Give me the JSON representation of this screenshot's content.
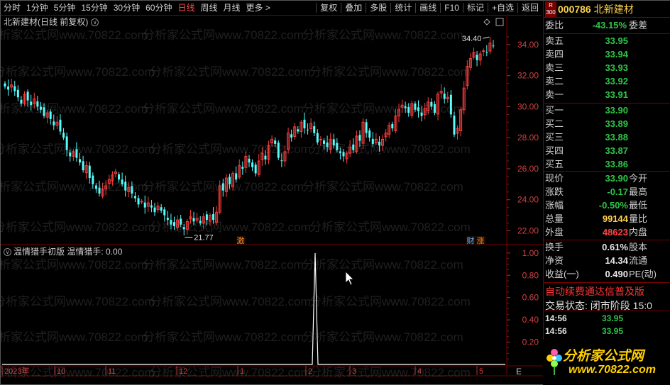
{
  "toolbar": {
    "periods": [
      "分时",
      "1分钟",
      "5分钟",
      "15分钟",
      "30分钟",
      "60分钟",
      "日线",
      "周线",
      "月线",
      "更多 >"
    ],
    "active_period": "日线",
    "actions": [
      "复权",
      "叠加",
      "多股",
      "统计",
      "画线",
      "F10",
      "标记",
      "+自选",
      "返回"
    ]
  },
  "main_chart": {
    "title": "北新建材(日线 前复权)",
    "high_label": "34.40",
    "low_label": "21.77",
    "markers": [
      "激",
      "财",
      "涨"
    ]
  },
  "indicator": {
    "name": "温情猎手初版",
    "value_label": "温情猎手: 0.00"
  },
  "x_axis": {
    "labels": [
      "2023年",
      "10",
      "11",
      "12",
      "1",
      "2",
      "3",
      "4",
      "5"
    ],
    "corner_label": "E"
  },
  "watermark": "分析家公式网www.70822.com",
  "quote_panel": {
    "badge_top": "R",
    "badge_bottom": "300",
    "code": "000786",
    "name": "北新建材",
    "weibi_label": "委比",
    "weibi_value": "-43.15%",
    "weicha_label": "委差",
    "sell": [
      {
        "label": "卖五",
        "price": "33.95"
      },
      {
        "label": "卖四",
        "price": "33.94"
      },
      {
        "label": "卖三",
        "price": "33.93"
      },
      {
        "label": "卖二",
        "price": "33.92"
      },
      {
        "label": "卖一",
        "price": "33.91"
      }
    ],
    "buy": [
      {
        "label": "买一",
        "price": "33.90"
      },
      {
        "label": "买二",
        "price": "33.89"
      },
      {
        "label": "买三",
        "price": "33.88"
      },
      {
        "label": "买四",
        "price": "33.87"
      },
      {
        "label": "买五",
        "price": "33.86"
      }
    ],
    "stats": [
      {
        "label": "现价",
        "value": "33.90",
        "label2": "今开"
      },
      {
        "label": "涨跌",
        "value": "-0.17",
        "label2": "最高"
      },
      {
        "label": "涨幅",
        "value": "-0.50%",
        "label2": "最低"
      },
      {
        "label": "总量",
        "value": "99144",
        "label2": "量比"
      },
      {
        "label": "外盘",
        "value": "48623",
        "label2": "内盘"
      }
    ],
    "fin": [
      {
        "label": "换手",
        "value": "0.61%",
        "label2": "股本"
      },
      {
        "label": "净资",
        "value": "14.34",
        "label2": "流通"
      },
      {
        "label": "收益(一)",
        "value": "0.490",
        "label2": "PE(动)"
      }
    ],
    "promo": "自动续费通达信普及版",
    "status": "交易状态: 闭市阶段 15:0",
    "ticks": [
      {
        "time": "14:56",
        "price": "33.95"
      },
      {
        "time": "14:56",
        "price": "33.95"
      },
      {
        "time": "14:56",
        "price": "33.95"
      }
    ]
  },
  "logo": {
    "main": "分析家公式网",
    "sub": "www.70822.com"
  },
  "chart_data": [
    {
      "type": "candlestick",
      "title": "北新建材(日线 前复权)",
      "y_ticks": [
        22.0,
        24.0,
        26.0,
        28.0,
        30.0,
        32.0,
        34.0
      ],
      "ylim": [
        21.2,
        35.0
      ],
      "annotations": [
        {
          "text": "34.40",
          "kind": "high"
        },
        {
          "text": "21.77",
          "kind": "low"
        }
      ],
      "closes": [
        31.3,
        31.1,
        31.4,
        31.0,
        30.6,
        30.2,
        30.8,
        30.4,
        30.1,
        30.5,
        30.0,
        29.8,
        29.4,
        29.6,
        29.2,
        28.8,
        29.0,
        28.4,
        28.0,
        27.2,
        26.8,
        27.1,
        26.7,
        26.4,
        25.9,
        26.2,
        25.4,
        25.0,
        24.7,
        24.4,
        24.7,
        24.9,
        25.3,
        25.6,
        25.8,
        25.3,
        25.0,
        24.6,
        24.8,
        24.4,
        24.1,
        23.7,
        23.9,
        23.5,
        23.8,
        23.5,
        23.2,
        23.6,
        23.3,
        23.0,
        22.7,
        22.4,
        22.3,
        22.7,
        22.4,
        22.1,
        22.6,
        22.9,
        22.6,
        22.8,
        22.5,
        22.9,
        22.7,
        23.0,
        22.7,
        23.2,
        24.9,
        24.6,
        25.4,
        25.0,
        25.7,
        25.3,
        26.2,
        26.0,
        26.8,
        26.4,
        26.1,
        25.7,
        26.5,
        27.0,
        26.6,
        27.5,
        27.9,
        27.6,
        26.7,
        26.5,
        27.1,
        28.3,
        28.0,
        28.7,
        28.4,
        29.0,
        28.6,
        28.5,
        28.9,
        28.3,
        27.7,
        27.9,
        27.6,
        27.4,
        27.9,
        27.5,
        27.2,
        27.0,
        26.8,
        27.0,
        27.4,
        27.2,
        28.1,
        27.8,
        29.0,
        28.3,
        28.0,
        27.6,
        27.9,
        27.5,
        27.9,
        28.3,
        28.8,
        28.6,
        29.4,
        29.8,
        30.1,
        29.9,
        29.6,
        30.2,
        29.8,
        29.7,
        29.4,
        29.9,
        30.3,
        30.0,
        29.6,
        30.8,
        31.0,
        30.5,
        30.6,
        29.5,
        28.2,
        28.6,
        29.8,
        31.2,
        32.6,
        33.1,
        33.5,
        33.0,
        33.4,
        33.6,
        33.5,
        34.1,
        33.9
      ]
    },
    {
      "type": "line",
      "series": [
        {
          "name": "温情猎手",
          "peak_value": 1.0
        }
      ],
      "y_ticks": [
        0.2,
        0.4,
        0.6,
        0.8,
        1.0
      ],
      "ylim": [
        0,
        1.05
      ]
    }
  ]
}
